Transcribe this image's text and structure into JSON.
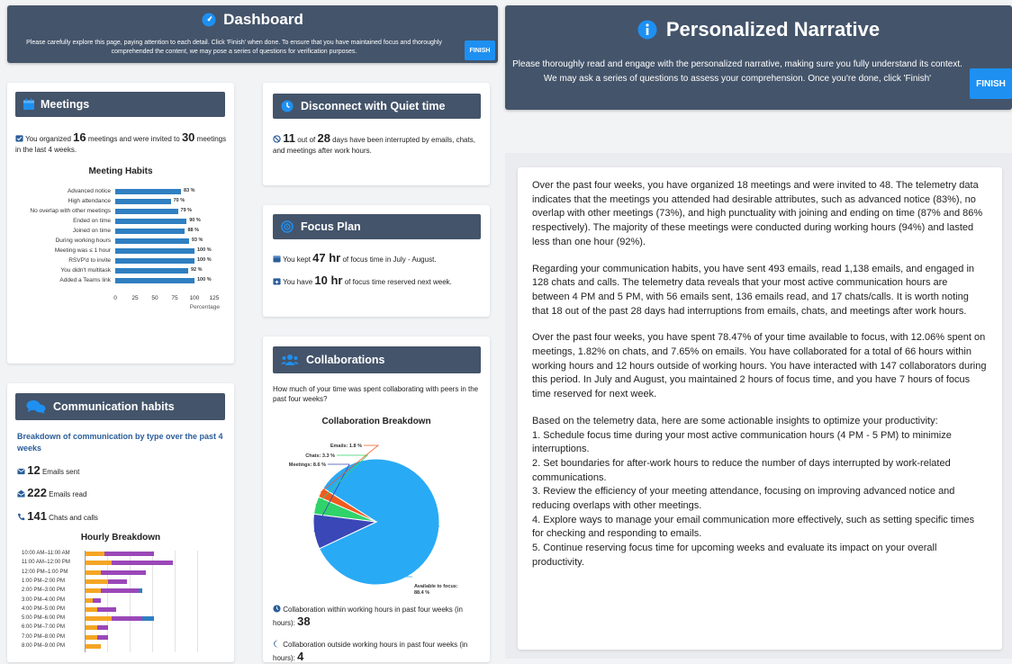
{
  "dashboard": {
    "title": "Dashboard",
    "instructions": "Please carefully explore this page, paying attention to each detail. Click 'Finish' when done. To ensure that you have maintained focus and thoroughly comprehended the content, we may pose a series of questions for verification purposes.",
    "finish_label": "FINISH"
  },
  "narrative_header": {
    "title": "Personalized Narrative",
    "instructions": "Please thoroughly read and engage with the personalized narrative, making sure you fully understand its context. We may ask a series of questions to assess your comprehension. Once you're done, click 'Finish'",
    "finish_label": "FINISH"
  },
  "meetings": {
    "title": "Meetings",
    "summary_pre": "You organized",
    "organized": "16",
    "summary_mid": "meetings and were invited to",
    "invited": "30",
    "summary_post": "meetings in the last 4 weeks.",
    "chart_title": "Meeting Habits"
  },
  "quiet": {
    "title": "Disconnect with Quiet time",
    "count": "11",
    "text_mid": "out of",
    "days": "28",
    "text_post": "days have been interrupted by emails, chats, and meetings after work hours."
  },
  "focus": {
    "title": "Focus Plan",
    "kept_pre": "You kept",
    "kept_value": "47 hr",
    "kept_post": "of focus time in July - August.",
    "reserved_pre": "You have",
    "reserved_value": "10 hr",
    "reserved_post": "of focus time reserved next week."
  },
  "collab": {
    "title": "Collaborations",
    "question": "How much of your time was spent collaborating with peers in the past four weeks?",
    "chart_title": "Collaboration Breakdown",
    "within_text": "Collaboration within working hours in past four weeks (in hours):",
    "within_value": "38",
    "outside_text": "Collaboration outside working hours in past four weeks (in hours):",
    "outside_value": "4"
  },
  "comm": {
    "title": "Communication habits",
    "subtitle": "Breakdown of communication by type over the past 4 weeks",
    "emails_sent": "12",
    "emails_sent_label": "Emails sent",
    "emails_read": "222",
    "emails_read_label": "Emails read",
    "chats": "141",
    "chats_label": "Chats and calls",
    "chart_title": "Hourly Breakdown"
  },
  "narrative": {
    "p1": "Over the past four weeks, you have organized 18 meetings and were invited to 48. The telemetry data indicates that the meetings you attended had desirable attributes, such as advanced notice (83%), no overlap with other meetings (73%), and high punctuality with joining and ending on time (87% and 86% respectively). The majority of these meetings were conducted during working hours (94%) and lasted less than one hour (92%).",
    "p2": "Regarding your communication habits, you have sent 493 emails, read 1,138 emails, and engaged in 128 chats and calls. The telemetry data reveals that your most active communication hours are between 4 PM and 5 PM, with 56 emails sent, 136 emails read, and 17 chats/calls. It is worth noting that 18 out of the past 28 days had interruptions from emails, chats, and meetings after work hours.",
    "p3": "Over the past four weeks, you have spent 78.47% of your time available to focus, with 12.06% spent on meetings, 1.82% on chats, and 7.65% on emails. You have collaborated for a total of 66 hours within working hours and 12 hours outside of working hours. You have interacted with 147 collaborators during this period. In July and August, you maintained 2 hours of focus time, and you have 7 hours of focus time reserved for next week.",
    "p4_lines": [
      "Based on the telemetry data, here are some actionable insights to optimize your productivity:",
      "1. Schedule focus time during your most active communication hours (4 PM - 5 PM) to minimize interruptions.",
      "2. Set boundaries for after-work hours to reduce the number of days interrupted by work-related communications.",
      "3. Review the efficiency of your meeting attendance, focusing on improving advanced notice and reducing overlaps with other meetings.",
      "4. Explore ways to manage your email communication more effectively, such as setting specific times for checking and responding to emails.",
      "5. Continue reserving focus time for upcoming weeks and evaluate its impact on your overall productivity."
    ]
  },
  "chart_data": [
    {
      "type": "bar",
      "title": "Meeting Habits",
      "orientation": "horizontal",
      "categories": [
        "Advanced notice",
        "High attendance",
        "No overlap with other meetings",
        "Ended on time",
        "Joined on time",
        "During working hours",
        "Meeting was ≤ 1 hour",
        "RSVP'd to invite",
        "You didn't multitask",
        "Added a Teams link"
      ],
      "values": [
        83,
        70,
        79,
        90,
        88,
        93,
        100,
        100,
        92,
        100
      ],
      "value_labels": [
        "83 %",
        "70 %",
        "79 %",
        "90 %",
        "88 %",
        "93 %",
        "100 %",
        "100 %",
        "92 %",
        "100 %"
      ],
      "xlabel": "Percentage",
      "xlim": [
        0,
        125
      ],
      "xticks": [
        "0",
        "25",
        "50",
        "75",
        "100",
        "125"
      ],
      "color": "#2f7fc1"
    },
    {
      "type": "pie",
      "title": "Collaboration Breakdown",
      "slices": [
        {
          "label": "Available to focus:",
          "value_label": "88.4 %",
          "value": 84.0,
          "color": "#29aaf5"
        },
        {
          "label": "Meetings:",
          "value_label": "8.6 %",
          "value": 9.0,
          "color": "#3a47b7"
        },
        {
          "label": "Chats:",
          "value_label": "3.3 %",
          "value": 4.5,
          "color": "#2fd36a"
        },
        {
          "label": "Emails:",
          "value_label": "1.8 %",
          "value": 2.5,
          "color": "#f05a1e"
        }
      ]
    },
    {
      "type": "bar",
      "title": "Hourly Breakdown",
      "orientation": "horizontal",
      "stacked": true,
      "categories": [
        "10:00 AM–11:00 AM",
        "11:00 AM–12:00 PM",
        "12:00 PM–1:00 PM",
        "1:00 PM–2:00 PM",
        "2:00 PM–3:00 PM",
        "3:00 PM–4:00 PM",
        "4:00 PM–5:00 PM",
        "5:00 PM–6:00 PM",
        "6:00 PM–7:00 PM",
        "7:00 PM–8:00 PM",
        "8:00 PM–9:00 PM"
      ],
      "series": [
        {
          "name": "",
          "color": "#f4a524",
          "values": [
            5,
            7,
            4,
            6,
            4,
            2,
            3,
            7,
            3,
            3,
            4
          ]
        },
        {
          "name": "",
          "color": "#9b47b8",
          "values": [
            13,
            16,
            12,
            5,
            10,
            2,
            5,
            8,
            3,
            3,
            0
          ]
        },
        {
          "name": "",
          "color": "#2f7fc1",
          "values": [
            0,
            0,
            0,
            0,
            1,
            0,
            0,
            3,
            0,
            0,
            0
          ]
        }
      ]
    }
  ],
  "colors": {
    "header_bg": "#44546a",
    "button": "#1e90f2",
    "accent_blue": "#2f7fc1"
  }
}
